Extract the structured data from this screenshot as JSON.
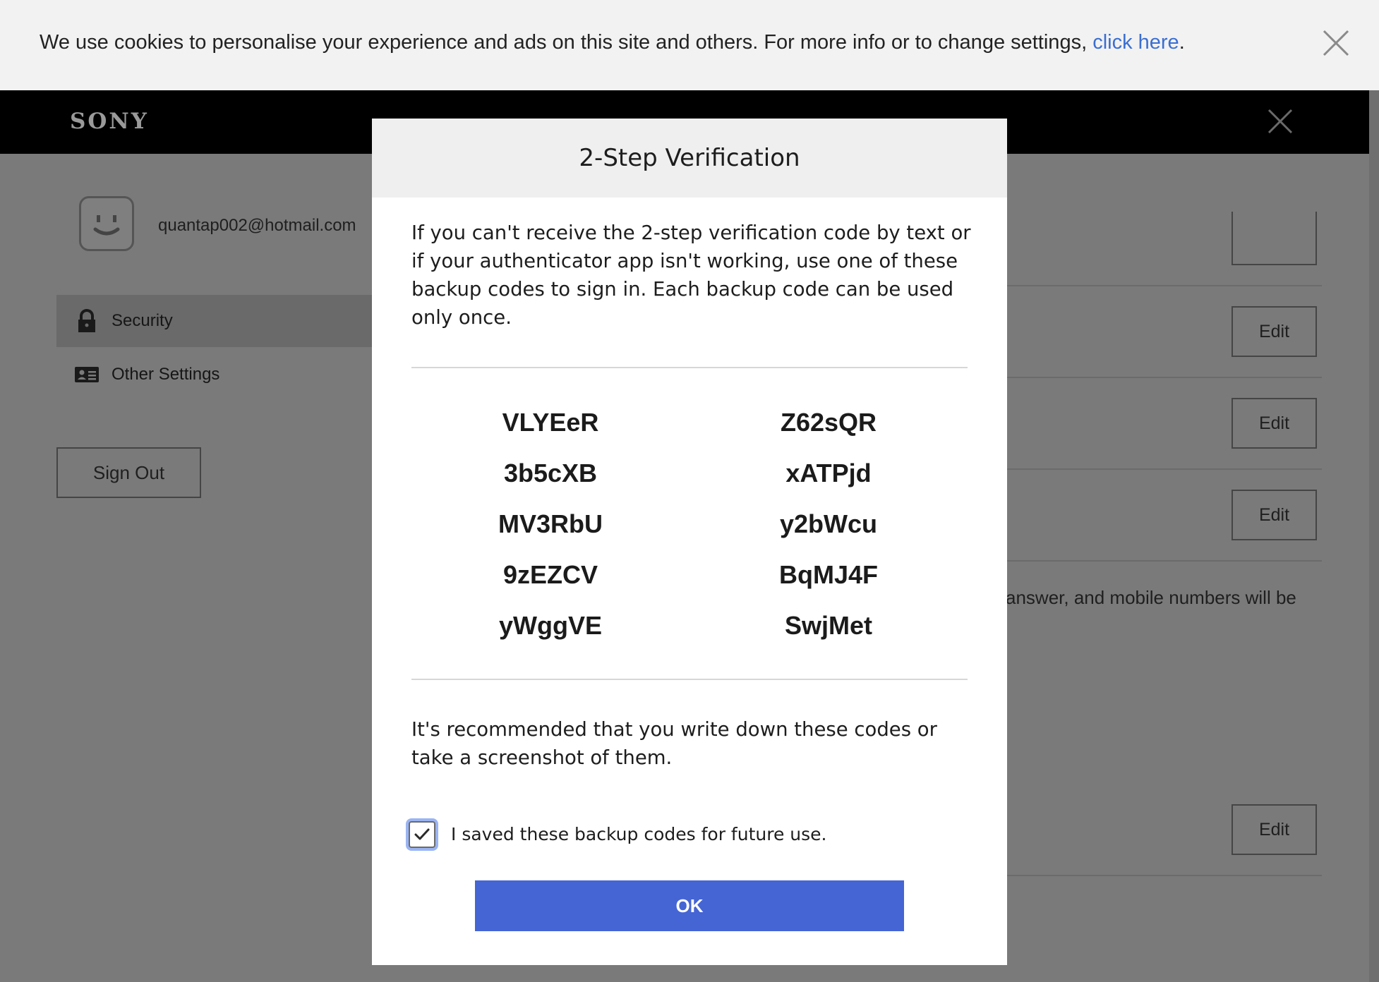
{
  "cookie_banner": {
    "text": "We use cookies to personalise your experience and ads on this site and others. For more info or to change settings, ",
    "link_label": "click here",
    "suffix": "."
  },
  "header": {
    "logo": "SONY"
  },
  "account": {
    "email": "quantap002@hotmail.com"
  },
  "sidebar": {
    "items": [
      {
        "label": "Security",
        "icon": "lock-icon",
        "active": true
      },
      {
        "label": "Other Settings",
        "icon": "id-card-icon",
        "active": false
      }
    ],
    "sign_out_label": "Sign Out"
  },
  "main": {
    "edit_label": "Edit",
    "partial_text": "answer, and mobile numbers will be"
  },
  "modal": {
    "title": "2-Step Verification",
    "intro": "If you can't receive the 2-step verification code by text or if your authenticator app isn't working, use one of these backup codes to sign in. Each backup code can be used only once.",
    "codes": [
      "VLYEeR",
      "Z62sQR",
      "3b5cXB",
      "xATPjd",
      "MV3RbU",
      "y2bWcu",
      "9zEZCV",
      "BqMJ4F",
      "yWggVE",
      "SwjMet"
    ],
    "note": "It's recommended that you write down these codes or take a screenshot of them.",
    "checkbox_label": "I saved these backup codes for future use.",
    "checkbox_checked": true,
    "ok_label": "OK"
  },
  "colors": {
    "link": "#3a6fd1",
    "primary_button": "#4565d4",
    "overlay": "#7a7a7a",
    "header": "#000000"
  }
}
